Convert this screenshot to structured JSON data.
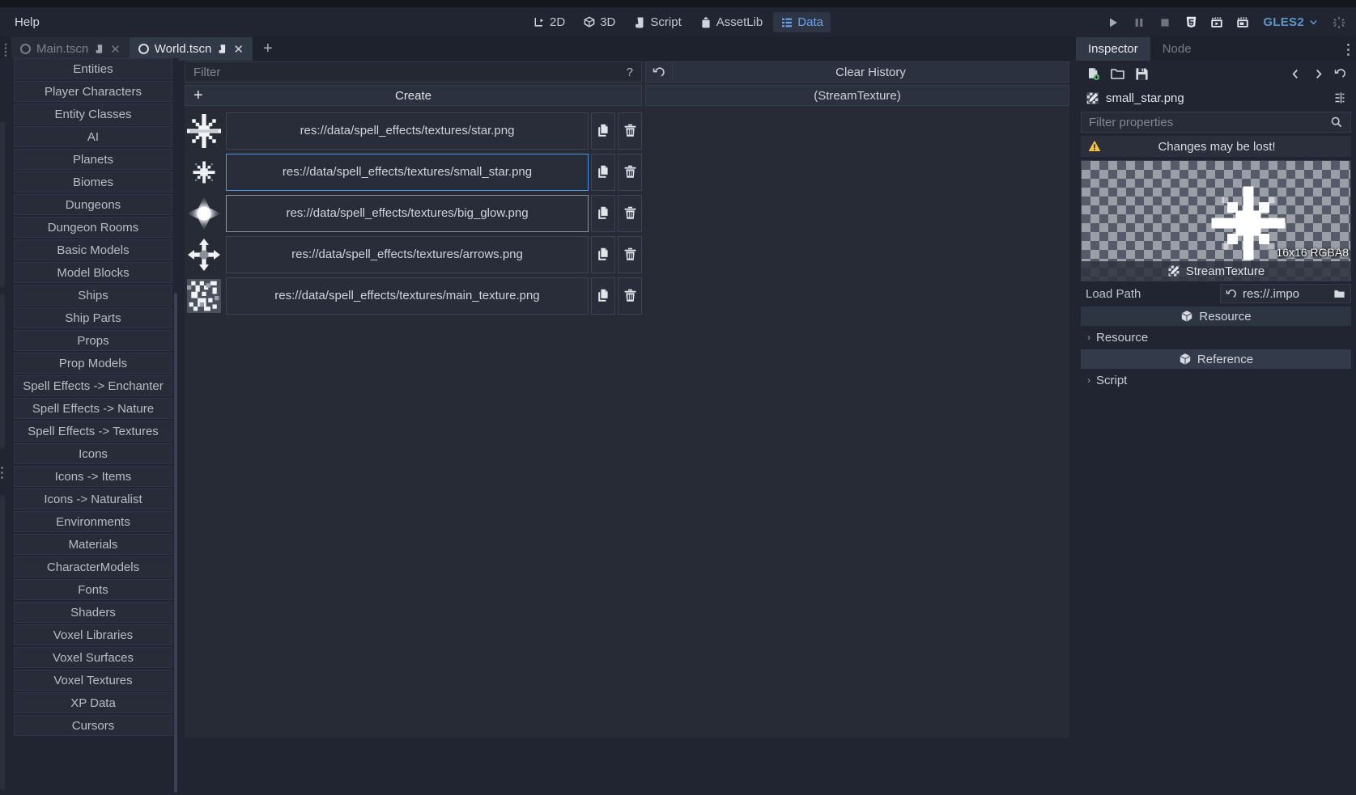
{
  "menu": {
    "help": "Help"
  },
  "mainmode": [
    {
      "label": "2D",
      "icon": "2d-icon",
      "active": false
    },
    {
      "label": "3D",
      "icon": "3d-icon",
      "active": false
    },
    {
      "label": "Script",
      "icon": "script-icon",
      "active": false
    },
    {
      "label": "AssetLib",
      "icon": "assetlib-icon",
      "active": false
    },
    {
      "label": "Data",
      "icon": "data-icon",
      "active": true
    }
  ],
  "playbar": {
    "buttons": [
      {
        "name": "play-button",
        "icon": "play-icon"
      },
      {
        "name": "pause-button",
        "icon": "pause-icon"
      },
      {
        "name": "stop-button",
        "icon": "stop-icon"
      },
      {
        "name": "play-html5-button",
        "icon": "html5-icon"
      },
      {
        "name": "play-scene-button",
        "icon": "play-scene-icon"
      },
      {
        "name": "play-custom-scene-button",
        "icon": "play-custom-scene-icon"
      }
    ],
    "renderer": "GLES2",
    "progress_icon": "spinner-icon"
  },
  "tabs": [
    {
      "label": "Main.tscn",
      "active": false,
      "close": "✕"
    },
    {
      "label": "World.tscn",
      "active": true,
      "close": "✕"
    }
  ],
  "tab_add": "+",
  "sidebar": {
    "items": [
      "Entities",
      "Player Characters",
      "Entity Classes",
      "AI",
      "Planets",
      "Biomes",
      "Dungeons",
      "Dungeon Rooms",
      "Basic Models",
      "Model Blocks",
      "Ships",
      "Ship Parts",
      "Props",
      "Prop Models",
      "Spell Effects -> Enchanter",
      "Spell Effects -> Nature",
      "Spell Effects -> Textures",
      "Icons",
      "Icons -> Items",
      "Icons -> Naturalist",
      "Environments",
      "Materials",
      "CharacterModels",
      "Fonts",
      "Shaders",
      "Voxel Libraries",
      "Voxel Surfaces",
      "Voxel Textures",
      "XP Data",
      "Cursors"
    ]
  },
  "center": {
    "filter_placeholder": "Filter",
    "filter_value": "",
    "help_glyph": "?",
    "create_label": "Create",
    "create_plus": "+",
    "clear_history_label": "Clear History",
    "undo_icon": "undo-icon",
    "stream_type": "(StreamTexture)",
    "rows": [
      {
        "path": "res://data/spell_effects/textures/star.png",
        "thumb": "star-thumb",
        "state": "normal"
      },
      {
        "path": "res://data/spell_effects/textures/small_star.png",
        "thumb": "small-star-thumb",
        "state": "selected"
      },
      {
        "path": "res://data/spell_effects/textures/big_glow.png",
        "thumb": "big-glow-thumb",
        "state": "hovered"
      },
      {
        "path": "res://data/spell_effects/textures/arrows.png",
        "thumb": "arrows-thumb",
        "state": "normal"
      },
      {
        "path": "res://data/spell_effects/textures/main_texture.png",
        "thumb": "main-texture-thumb",
        "state": "normal"
      }
    ],
    "row_duplicate_icon": "duplicate-icon",
    "row_delete_icon": "trash-icon"
  },
  "inspector": {
    "tabs": [
      {
        "label": "Inspector",
        "active": true
      },
      {
        "label": "Node",
        "active": false
      }
    ],
    "toolbar": [
      {
        "name": "new-resource-button",
        "icon": "new-file-icon"
      },
      {
        "name": "open-resource-button",
        "icon": "folder-icon"
      },
      {
        "name": "save-resource-button",
        "icon": "save-icon"
      }
    ],
    "toolbar_right": [
      {
        "name": "history-prev-button",
        "icon": "chevron-left-icon"
      },
      {
        "name": "history-next-button",
        "icon": "chevron-right-icon"
      },
      {
        "name": "history-button",
        "icon": "history-icon"
      }
    ],
    "object_name": "small_star.png",
    "object_icon": "streamtexture-icon",
    "object_action_icon": "object-menu-icon",
    "filter_placeholder": "Filter properties",
    "filter_value": "",
    "search_icon": "search-icon",
    "warning": "Changes may be lost!",
    "warning_icon": "warning-icon",
    "preview": {
      "dimensions": "16x16 RGBA8",
      "type_label": "StreamTexture",
      "type_icon": "streamtexture-icon"
    },
    "properties": [
      {
        "kind": "prop",
        "label": "Load Path",
        "value": "res://.impo",
        "revert_icon": "revert-icon",
        "folder_icon": "folder-open-icon"
      },
      {
        "kind": "category",
        "label": "Resource",
        "icon": "class-icon",
        "sub": false
      },
      {
        "kind": "tree",
        "label": "Resource",
        "chevron": "›"
      },
      {
        "kind": "category",
        "label": "Reference",
        "icon": "class-icon",
        "sub": true
      },
      {
        "kind": "tree",
        "label": "Script",
        "chevron": "›"
      }
    ]
  },
  "colors": {
    "accent": "#5294e2",
    "bg": "#202531",
    "panel": "#262b36",
    "active_tab": "#313846",
    "gles_blue": "#5e95c9",
    "warning": "#f5c33b"
  }
}
